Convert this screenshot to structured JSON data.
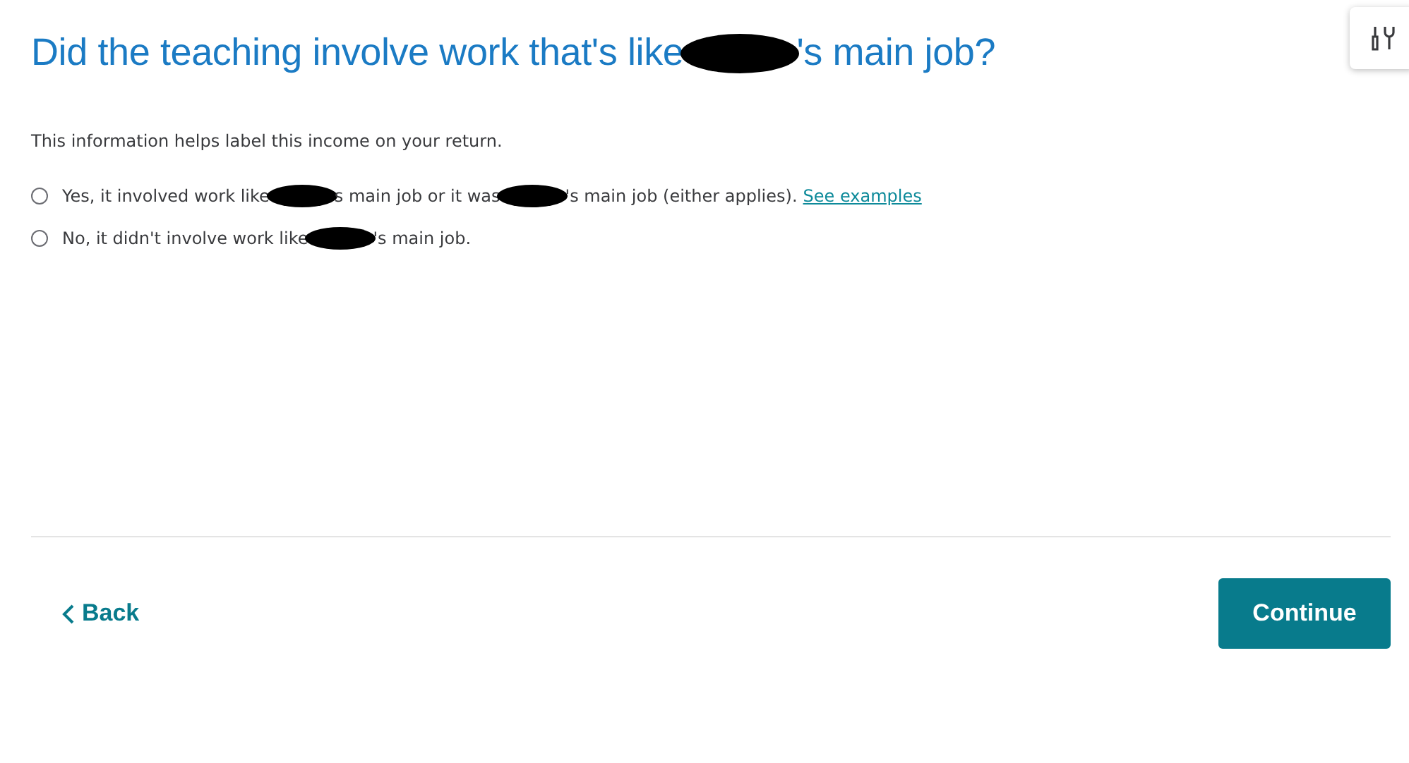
{
  "title_parts": [
    "Did the teaching involve work that's like",
    "'s main job?"
  ],
  "description": "This information helps label this income on your return.",
  "options": [
    {
      "text_parts": [
        "Yes, it involved work like",
        "s main job or it was",
        "'s main job (either applies)."
      ],
      "link": "See examples",
      "selected": false
    },
    {
      "text_parts": [
        "No, it didn't involve work like",
        "'s main job."
      ],
      "selected": false
    }
  ],
  "back": "Back",
  "continue": "Continue"
}
